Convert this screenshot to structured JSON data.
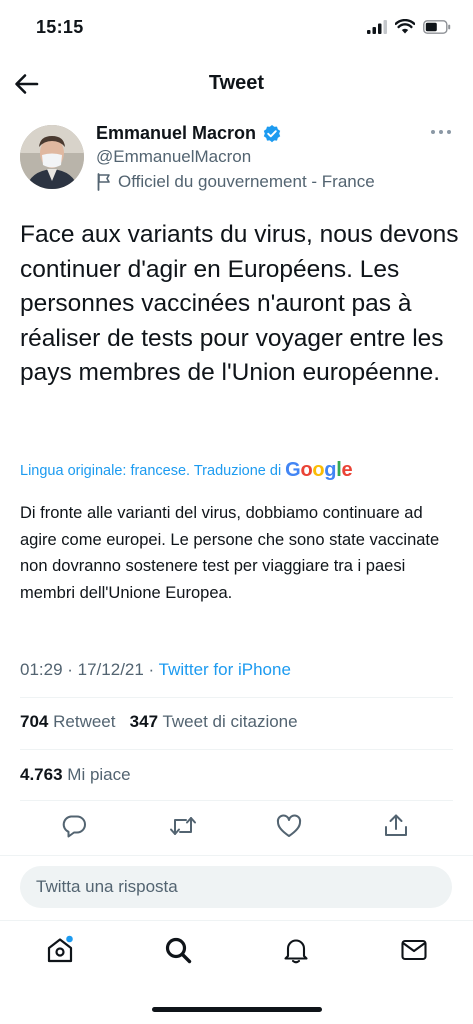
{
  "status_bar": {
    "time": "15:15"
  },
  "header": {
    "title": "Tweet"
  },
  "author": {
    "name": "Emmanuel Macron",
    "handle": "@EmmanuelMacron",
    "label": "Officiel du gouvernement - France"
  },
  "tweet": {
    "text": "Face aux variants du virus, nous devons continuer d'agir en Européens. Les personnes vaccinées n'auront pas à réaliser de tests pour voyager entre les pays membres de l'Union européenne.",
    "translation_note": "Lingua originale: francese. Traduzione di",
    "translation_provider": "Google",
    "translated_text": "Di fronte alle varianti del virus, dobbiamo continuare ad agire come europei. Le persone che sono state vaccinate non dovranno sostenere test per viaggiare tra i paesi membri dell'Unione Europea.",
    "timestamp": "01:29 · 17/12/21 · ",
    "source": "Twitter for iPhone"
  },
  "stats": {
    "retweets_count": "704",
    "retweets_label": "Retweet",
    "quotes_count": "347",
    "quotes_label": "Tweet di citazione",
    "likes_count": "4.763",
    "likes_label": "Mi piace"
  },
  "reply": {
    "placeholder": "Twitta una risposta"
  },
  "icons": {
    "verified": "verified-badge-icon",
    "reply": "reply-icon",
    "retweet": "retweet-icon",
    "like": "heart-icon",
    "share": "share-icon"
  },
  "colors": {
    "accent": "#1d9bf0",
    "text": "#0f1419",
    "secondary": "#536471"
  }
}
